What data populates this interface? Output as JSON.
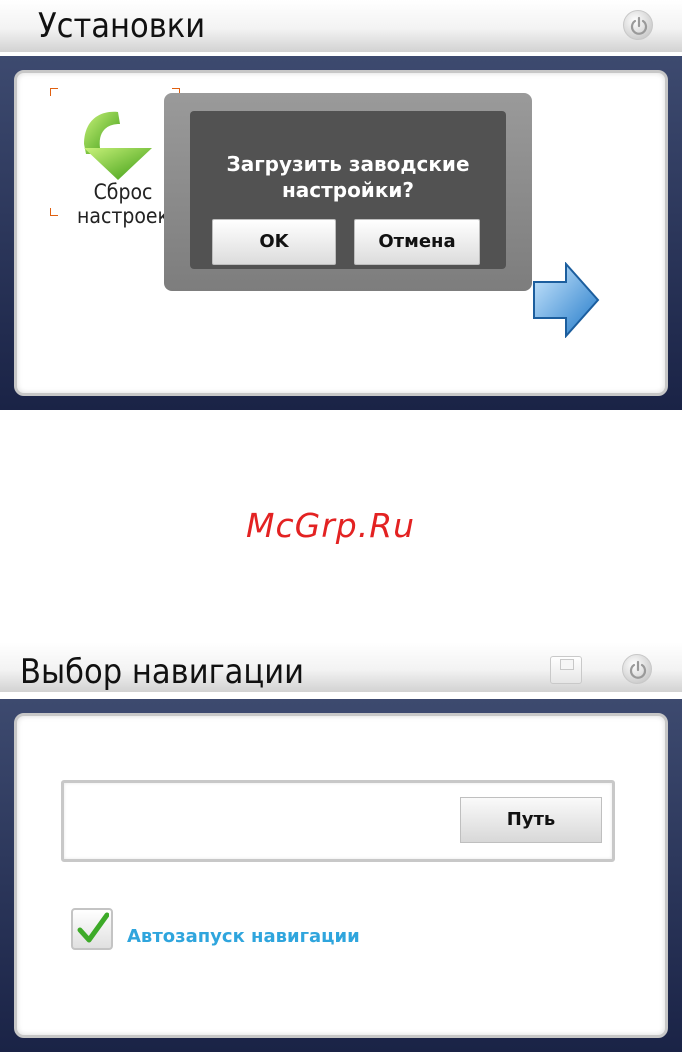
{
  "screen1": {
    "title": "Установки",
    "reset_tile": {
      "label": "Сброс настроек"
    },
    "dialog": {
      "message": "Загрузить заводские настройки?",
      "ok_label": "OK",
      "cancel_label": "Отмена"
    },
    "icons": [
      "power-icon",
      "arrow-down-icon",
      "next-arrow-icon"
    ]
  },
  "watermark": "McGrp.Ru",
  "screen2": {
    "title": "Выбор навигации",
    "path_button_label": "Путь",
    "path_value": "",
    "autostart": {
      "label": "Автозапуск навигации",
      "checked": true
    },
    "icons": [
      "save-icon",
      "power-icon",
      "checkmark-icon"
    ]
  },
  "colors": {
    "panel_frame": "#1f2a4d",
    "dialog_bg": "#525252",
    "link_blue": "#2fa5dd",
    "watermark_red": "#e32222",
    "arrow_green": "#5cbf1e",
    "arrow_blue": "#2f8fd8"
  }
}
